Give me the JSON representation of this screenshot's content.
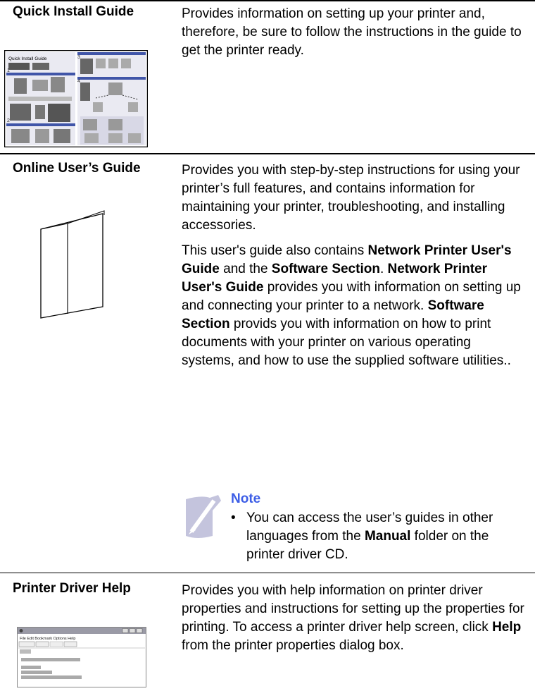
{
  "rows": [
    {
      "title": "Quick Install Guide",
      "paragraphs": [
        [
          {
            "t": "Provides information on setting up your printer and, therefore, be sure to follow the instructions in the guide to get the printer ready."
          }
        ]
      ],
      "thumbnail": {
        "caption": "Quick Install Guide"
      }
    },
    {
      "title": "Online User’s Guide",
      "paragraphs": [
        [
          {
            "t": "Provides you with step-by-step instructions for using your printer’s full features, and contains information for maintaining your printer, troubleshooting, and installing accessories."
          }
        ],
        [
          {
            "t": "This user's guide also contains "
          },
          {
            "t": "Network Printer User's Guide",
            "b": true
          },
          {
            "t": " and the "
          },
          {
            "t": "Software Section",
            "b": true
          },
          {
            "t": ". "
          },
          {
            "t": "Network Printer User's Guide",
            "b": true
          },
          {
            "t": " provides you with information on setting up and connecting your printer to a network. "
          },
          {
            "t": "Software Section",
            "b": true
          },
          {
            "t": " provids you with information on how to print documents with your printer on various operating systems, and how to use the supplied software utilities.."
          }
        ]
      ],
      "note": {
        "heading": "Note",
        "bullet": "•",
        "text": [
          {
            "t": "You can access the user’s guides in other languages from the "
          },
          {
            "t": "Manual",
            "b": true
          },
          {
            "t": " folder on the printer driver CD."
          }
        ]
      }
    },
    {
      "title": "Printer Driver Help",
      "paragraphs": [
        [
          {
            "t": "Provides you with help information on printer driver properties and instructions for setting up the properties for printing. To access a printer driver help screen, click "
          },
          {
            "t": "Help",
            "b": true
          },
          {
            "t": " from the printer properties dialog box."
          }
        ]
      ],
      "thumbnail": {
        "menu": "File  Edit  Bookmark  Options  Help",
        "tabs": [
          "Contents",
          "Index",
          "Back",
          "Print"
        ]
      }
    }
  ],
  "colors": {
    "note_heading": "#3d5ee6",
    "note_icon": "#b9b9d6"
  }
}
